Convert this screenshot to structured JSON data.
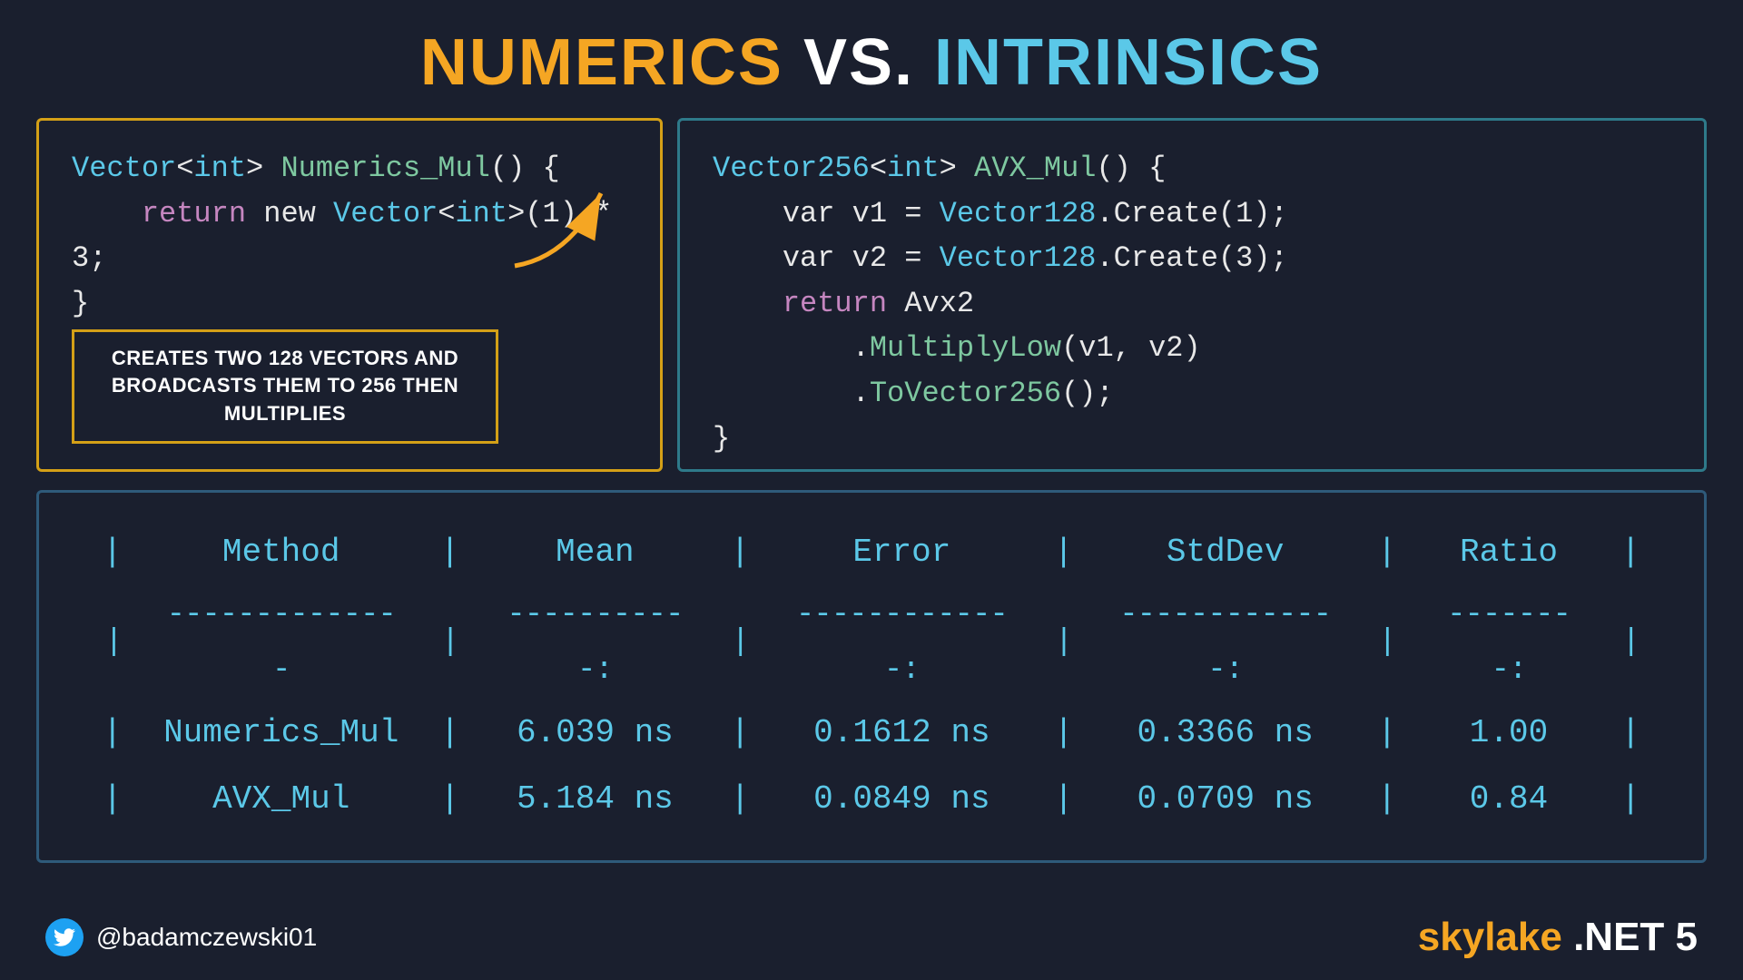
{
  "title": {
    "numerics": "NUMERICS",
    "vs": "VS.",
    "intrinsics": "INTRINSICS"
  },
  "left_panel": {
    "line1_prefix": "Vector<int> Numerics_Mul() {",
    "line2": "    return new Vector<int>(1) * 3;",
    "line3": "}",
    "annotation": "CREATES TWO 128 VECTORS AND BROADCASTS THEM TO 256 THEN MULTIPLIES"
  },
  "right_panel": {
    "line1": "Vector256<int> AVX_Mul() {",
    "line2": "    var v1 = Vector128.Create(1);",
    "line3": "    var v2 = Vector128.Create(3);",
    "line4_kw": "return",
    "line4_val": " Avx2",
    "line5": "        .MultiplyLow(v1, v2)",
    "line6": "        .ToVector256();",
    "line7": "}"
  },
  "benchmark": {
    "headers": [
      "Method",
      "Mean",
      "Error",
      "StdDev",
      "Ratio"
    ],
    "separator": [
      "--------------",
      "-----------:",
      "-------------:",
      "-------------:",
      "--------:"
    ],
    "rows": [
      [
        "Numerics_Mul",
        "6.039 ns",
        "0.1612 ns",
        "0.3366 ns",
        "1.00"
      ],
      [
        "AVX_Mul",
        "5.184 ns",
        "0.0849 ns",
        "0.0709 ns",
        "0.84"
      ]
    ]
  },
  "footer": {
    "handle": "@badamczewski01",
    "brand_skylake": "skylake",
    "brand_dotnet": ".NET 5"
  }
}
